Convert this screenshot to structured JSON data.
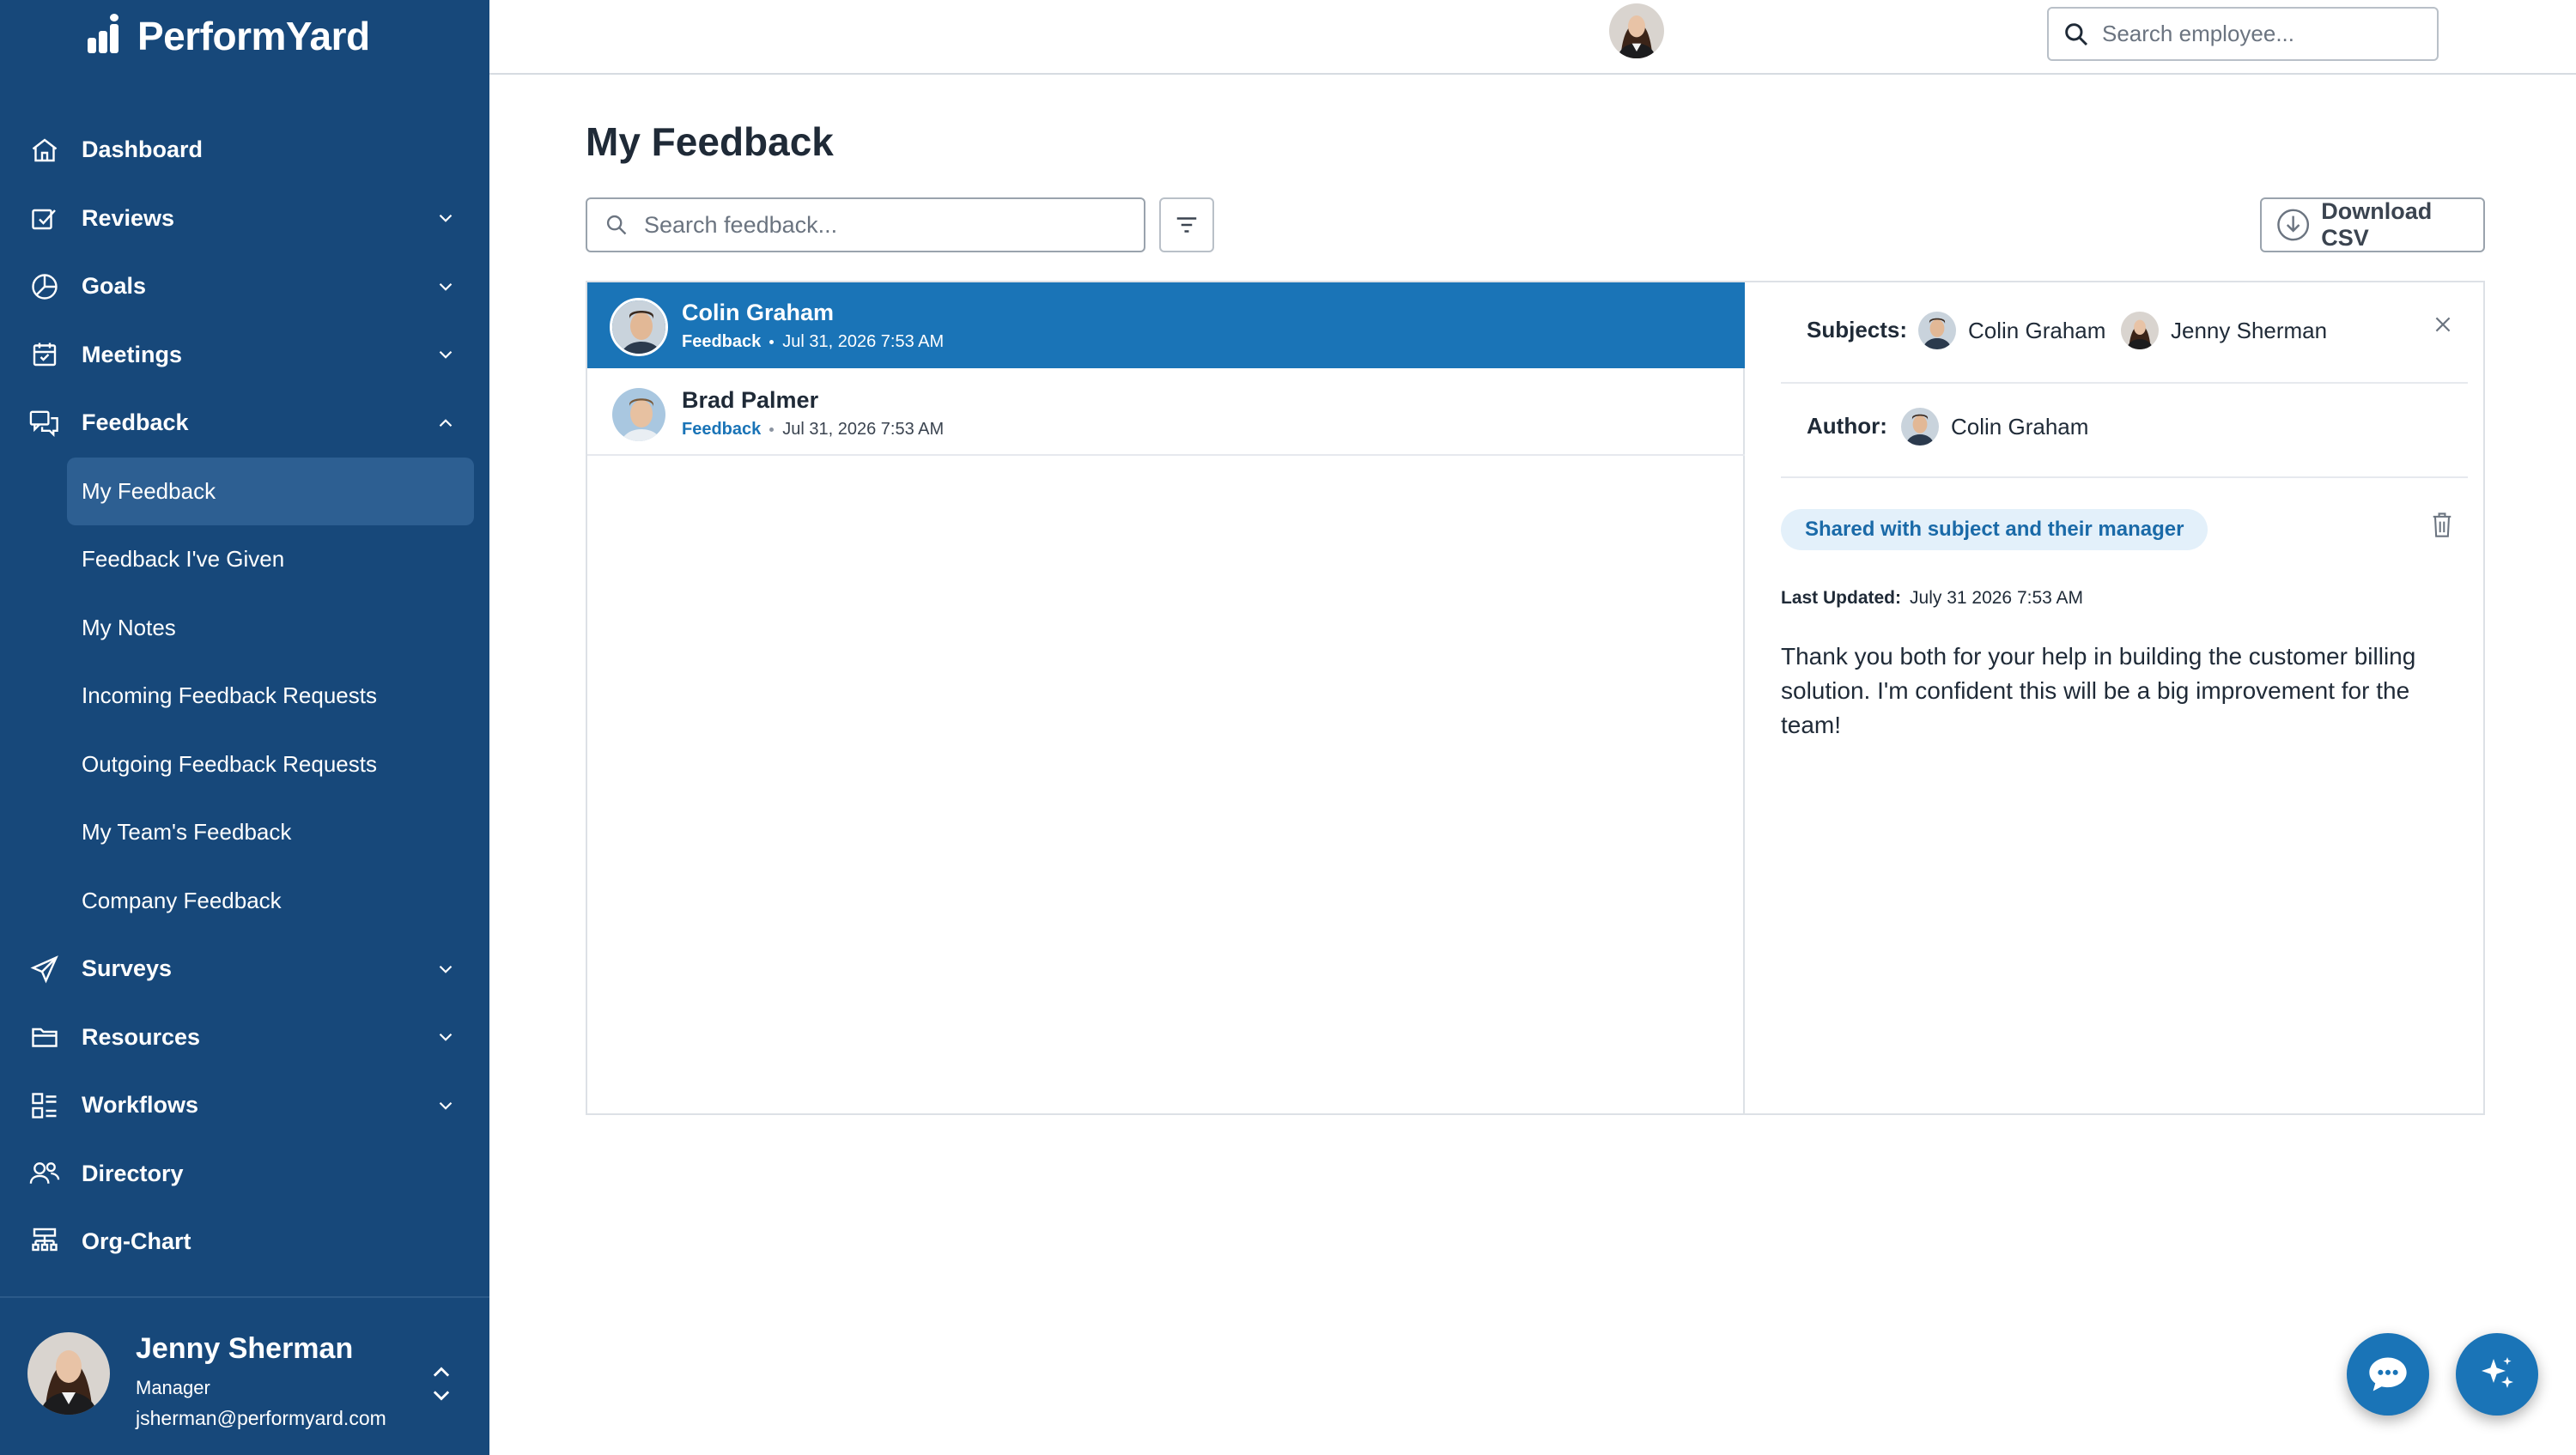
{
  "app": {
    "name": "PerformYard",
    "brand_color": "#17487a",
    "accent_color": "#1a74b7"
  },
  "sidebar": {
    "items": [
      {
        "label": "Dashboard",
        "icon": "home-icon",
        "expandable": false
      },
      {
        "label": "Reviews",
        "icon": "review-icon",
        "expandable": true
      },
      {
        "label": "Goals",
        "icon": "goals-icon",
        "expandable": true
      },
      {
        "label": "Meetings",
        "icon": "calendar-icon",
        "expandable": true
      },
      {
        "label": "Feedback",
        "icon": "chat-icon",
        "expandable": true,
        "expanded": true
      }
    ],
    "feedback_sub": [
      {
        "label": "My Feedback",
        "active": true
      },
      {
        "label": "Feedback I've Given"
      },
      {
        "label": "My Notes"
      },
      {
        "label": "Incoming Feedback Requests"
      },
      {
        "label": "Outgoing Feedback Requests"
      },
      {
        "label": "My Team's Feedback"
      },
      {
        "label": "Company Feedback"
      }
    ],
    "items_after": [
      {
        "label": "Surveys",
        "icon": "send-icon",
        "expandable": true
      },
      {
        "label": "Resources",
        "icon": "folder-icon",
        "expandable": true
      },
      {
        "label": "Workflows",
        "icon": "workflow-icon",
        "expandable": true
      },
      {
        "label": "Directory",
        "icon": "people-icon",
        "expandable": false
      },
      {
        "label": "Org-Chart",
        "icon": "org-chart-icon",
        "expandable": false
      }
    ],
    "user": {
      "name": "Jenny Sherman",
      "role": "Manager",
      "email": "jsherman@performyard.com"
    }
  },
  "topbar": {
    "search_placeholder": "Search employee..."
  },
  "main": {
    "title": "My Feedback",
    "search_placeholder": "Search feedback...",
    "download_label": "Download CSV",
    "list": [
      {
        "name": "Colin Graham",
        "tag": "Feedback",
        "date": "Jul 31, 2026 7:53 AM",
        "selected": true
      },
      {
        "name": "Brad Palmer",
        "tag": "Feedback",
        "date": "Jul 31, 2026 7:53 AM",
        "selected": false
      }
    ],
    "detail": {
      "subjects_label": "Subjects:",
      "subjects": [
        "Colin Graham",
        "Jenny Sherman"
      ],
      "author_label": "Author:",
      "author": "Colin Graham",
      "visibility": "Shared with subject and their manager",
      "last_updated_label": "Last Updated:",
      "last_updated": "July 31 2026 7:53 AM",
      "text": "Thank you both for your help in building the customer billing solution.  I'm confident this will be a big improvement for the team!"
    }
  }
}
